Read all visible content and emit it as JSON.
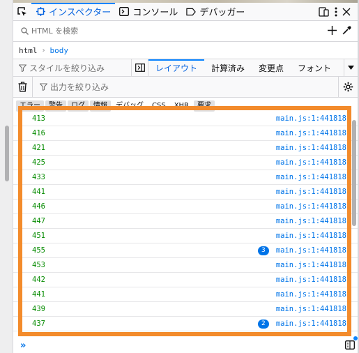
{
  "toolbar": {
    "tabs": [
      {
        "label": "インスペクター",
        "icon": "inspector-icon",
        "selected": true
      },
      {
        "label": "コンソール",
        "icon": "console-icon",
        "selected": false
      },
      {
        "label": "デバッガー",
        "icon": "debugger-icon",
        "selected": false
      }
    ]
  },
  "search": {
    "placeholder": "HTML を検索"
  },
  "breadcrumb": {
    "items": [
      "html",
      "body"
    ]
  },
  "sidebar": {
    "rule_filter_placeholder": "スタイルを絞り込み",
    "tabs": [
      "レイアウト",
      "計算済み",
      "変更点",
      "フォント"
    ],
    "selected_tab": "レイアウト"
  },
  "console": {
    "filter_placeholder": "出力を絞り込み",
    "chips": [
      "エラー",
      "警告",
      "ログ",
      "情報",
      "デバッグ",
      "CSS",
      "XHR",
      "要求"
    ],
    "messages": [
      {
        "value": "413",
        "location": "main.js:1:441818",
        "repeat": ""
      },
      {
        "value": "416",
        "location": "main.js:1:441818",
        "repeat": ""
      },
      {
        "value": "421",
        "location": "main.js:1:441818",
        "repeat": ""
      },
      {
        "value": "425",
        "location": "main.js:1:441818",
        "repeat": ""
      },
      {
        "value": "433",
        "location": "main.js:1:441818",
        "repeat": ""
      },
      {
        "value": "441",
        "location": "main.js:1:441818",
        "repeat": ""
      },
      {
        "value": "446",
        "location": "main.js:1:441818",
        "repeat": ""
      },
      {
        "value": "447",
        "location": "main.js:1:441818",
        "repeat": ""
      },
      {
        "value": "451",
        "location": "main.js:1:441818",
        "repeat": ""
      },
      {
        "value": "455",
        "location": "main.js:1:441818",
        "repeat": "3"
      },
      {
        "value": "453",
        "location": "main.js:1:441818",
        "repeat": ""
      },
      {
        "value": "442",
        "location": "main.js:1:441818",
        "repeat": ""
      },
      {
        "value": "441",
        "location": "main.js:1:441818",
        "repeat": ""
      },
      {
        "value": "439",
        "location": "main.js:1:441818",
        "repeat": ""
      },
      {
        "value": "437",
        "location": "main.js:1:441818",
        "repeat": "2"
      }
    ],
    "prompt": "»"
  },
  "colors": {
    "accent": "#0a84ff",
    "highlight": "#f38b2b",
    "value_green": "#058b00",
    "link_blue": "#0074e8"
  }
}
